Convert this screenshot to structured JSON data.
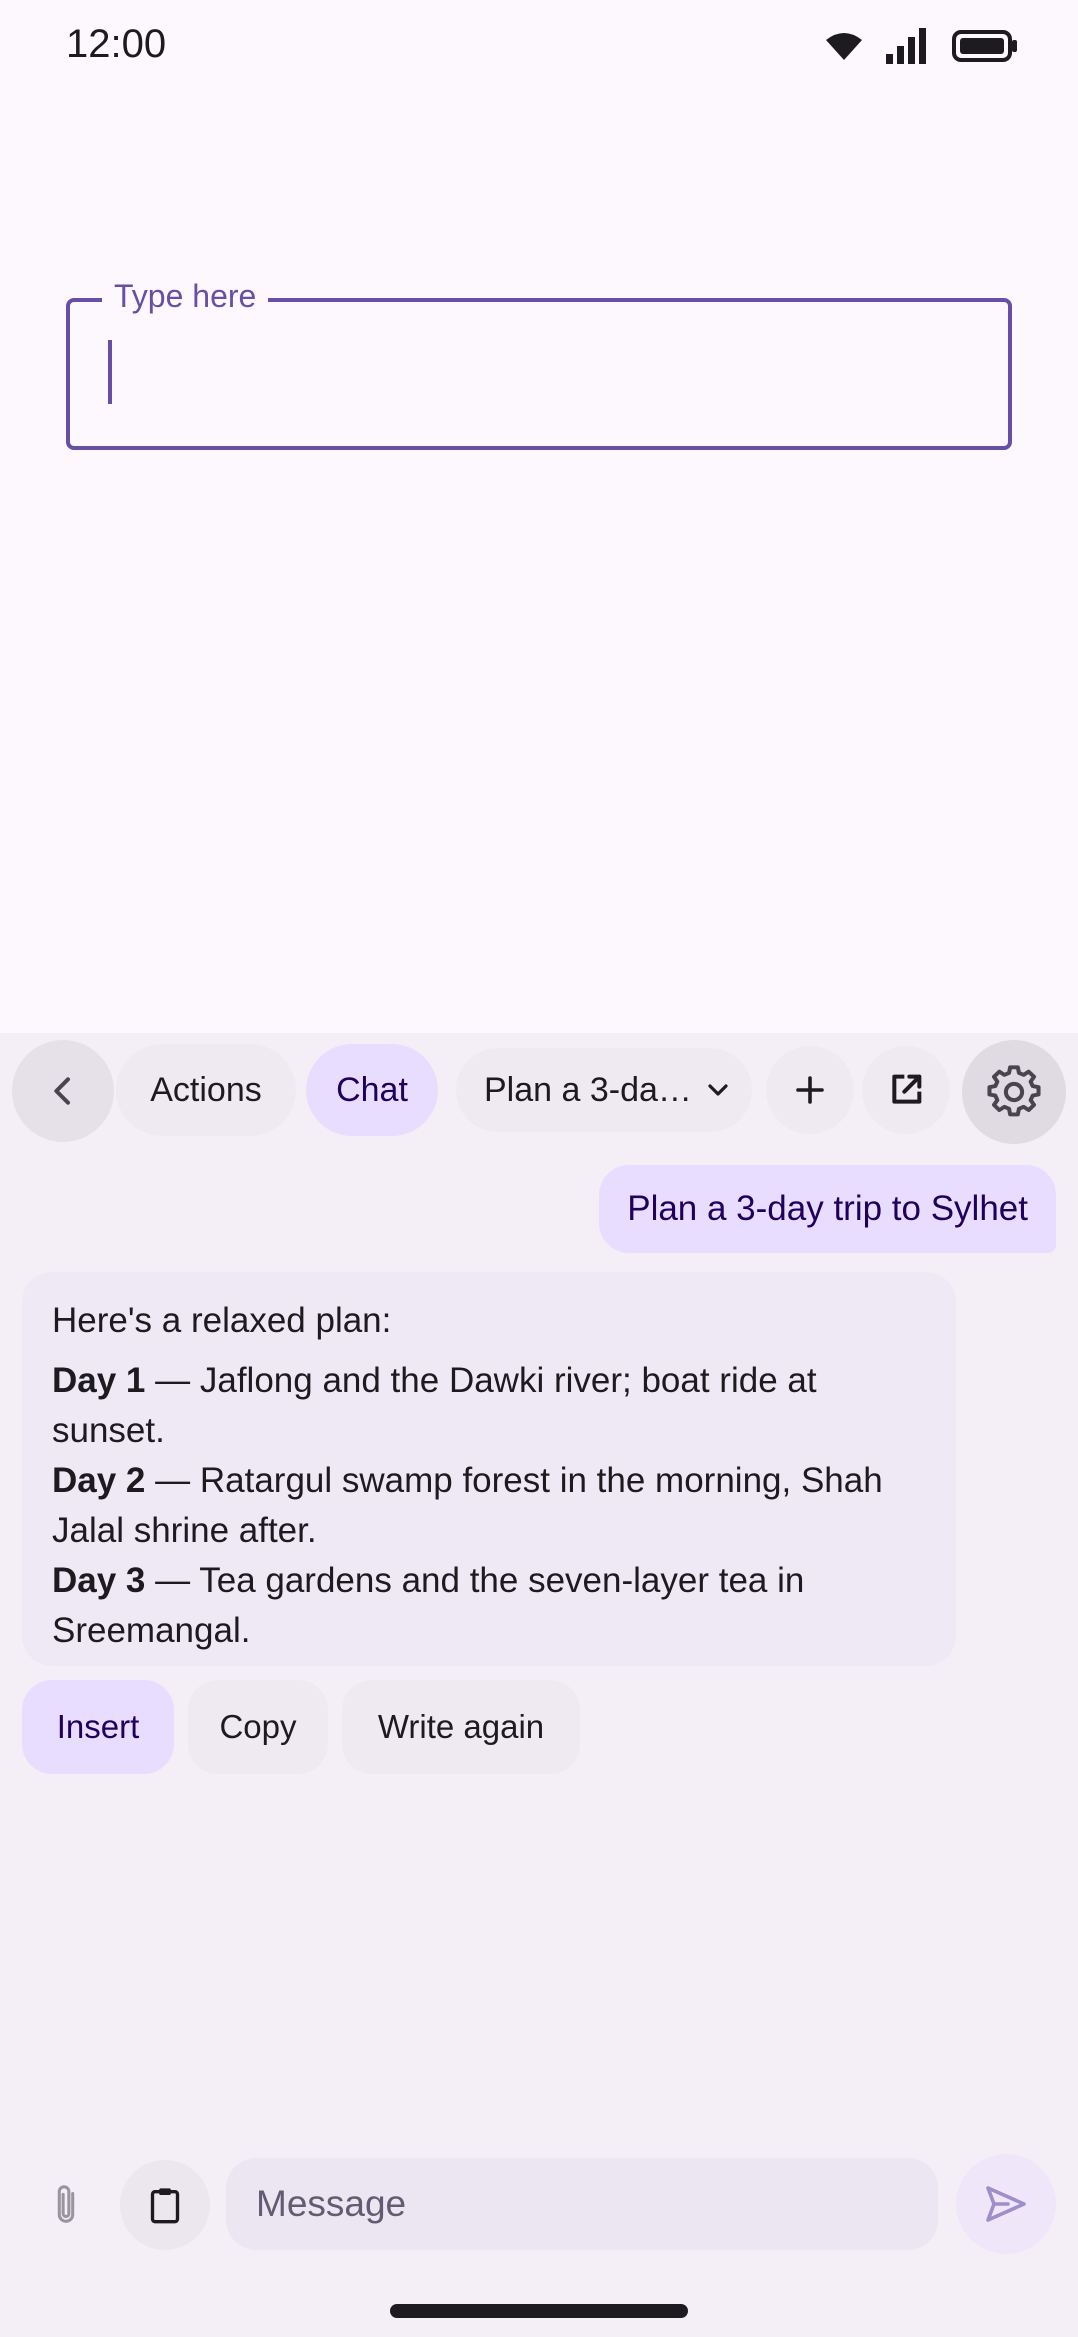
{
  "status_bar": {
    "time": "12:00"
  },
  "text_field": {
    "label": "Type here",
    "value": ""
  },
  "toolbar": {
    "actions_label": "Actions",
    "chat_label": "Chat",
    "conversation_select": "Plan a 3-da…"
  },
  "chat": {
    "user_message": "Plan a 3-day trip to Sylhet",
    "ai_reply": {
      "intro": "Here's a relaxed plan:",
      "days": [
        {
          "label": "Day 1",
          "text": " — Jaflong and the Dawki river; boat ride at sunset."
        },
        {
          "label": "Day 2",
          "text": " — Ratargul swamp forest in the morning, Shah Jalal shrine after."
        },
        {
          "label": "Day 3",
          "text": " — Tea gardens and the seven-layer tea in Sreemangal."
        }
      ]
    }
  },
  "reply_actions": {
    "insert_label": "Insert",
    "copy_label": "Copy",
    "write_again_label": "Write again"
  },
  "input_bar": {
    "placeholder": "Message",
    "value": ""
  },
  "icons": {
    "back": "chevron-left-icon",
    "dropdown": "chevron-down-icon",
    "add": "plus-icon",
    "open_external": "open-in-new-icon",
    "settings": "gear-icon",
    "attach": "paperclip-icon",
    "clipboard": "clipboard-icon",
    "send": "send-icon"
  },
  "colors": {
    "primary": "#6750a4",
    "chip_selected": "#e9ddff",
    "panel_background": "#f4eff7",
    "page_background": "#fdf7fe"
  }
}
